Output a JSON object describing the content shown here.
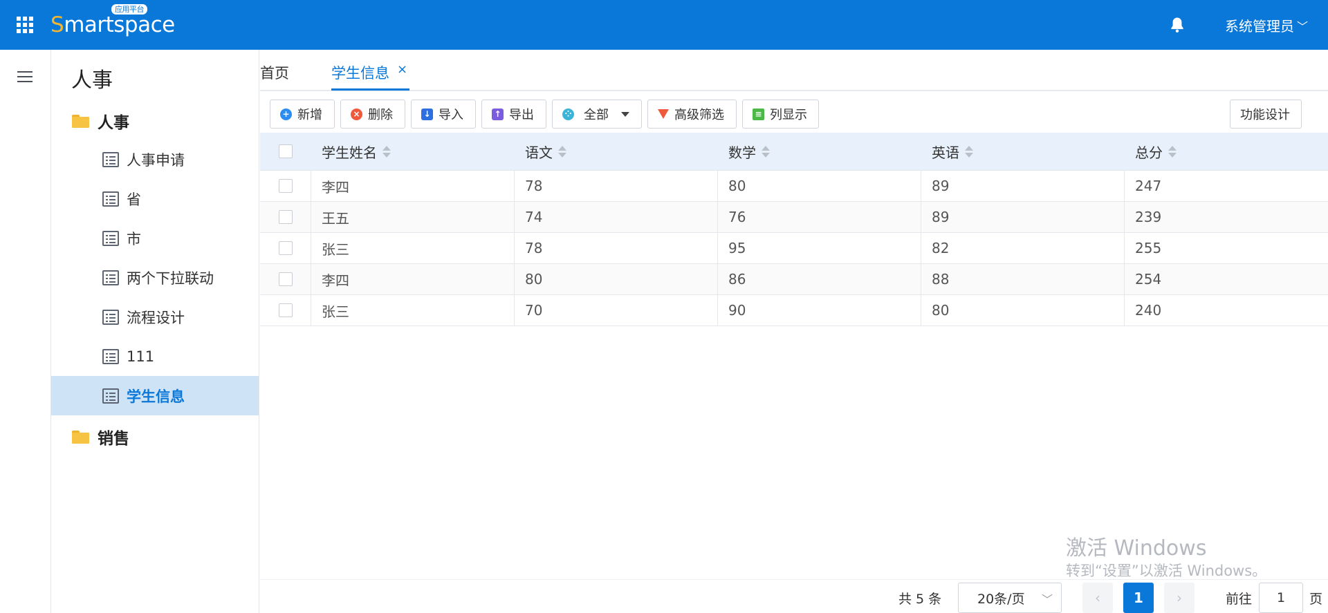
{
  "header": {
    "logo": "Smartspace",
    "logo_first": "S",
    "logo_rest": "martspace",
    "logo_badge": "应用平台",
    "user_name": "系统管理员",
    "user_chevron": "﹀"
  },
  "sidebar": {
    "title": "人事",
    "groups": [
      {
        "label": "人事",
        "items": [
          "人事申请",
          "省",
          "市",
          "两个下拉联动",
          "流程设计",
          "111",
          "学生信息"
        ]
      },
      {
        "label": "销售"
      }
    ],
    "active_item": "学生信息"
  },
  "tabs": [
    {
      "label": "首页"
    },
    {
      "label": "学生信息",
      "active": true,
      "close": "×"
    }
  ],
  "toolbar": {
    "add": "新增",
    "delete": "删除",
    "import": "导入",
    "export": "导出",
    "all": "全部",
    "advanced_filter": "高级筛选",
    "column_display": "列显示",
    "function_design": "功能设计"
  },
  "table": {
    "columns": [
      "学生姓名",
      "语文",
      "数学",
      "英语",
      "总分"
    ],
    "rows": [
      [
        "李四",
        "78",
        "80",
        "89",
        "247"
      ],
      [
        "王五",
        "74",
        "76",
        "89",
        "239"
      ],
      [
        "张三",
        "78",
        "95",
        "82",
        "255"
      ],
      [
        "李四",
        "80",
        "86",
        "88",
        "254"
      ],
      [
        "张三",
        "70",
        "90",
        "80",
        "240"
      ]
    ]
  },
  "pager": {
    "total": "共 5 条",
    "page_size": "20条/页",
    "current_page": "1",
    "goto_label": "前往",
    "goto_value": "1",
    "page_suffix": "页"
  },
  "watermark": {
    "line1": "激活 Windows",
    "line2": "转到“设置”以激活 Windows。"
  },
  "colors": {
    "brand": "#0a78d8",
    "header_bg": "#0a78d8",
    "active_item_bg": "#cfe3f7"
  }
}
